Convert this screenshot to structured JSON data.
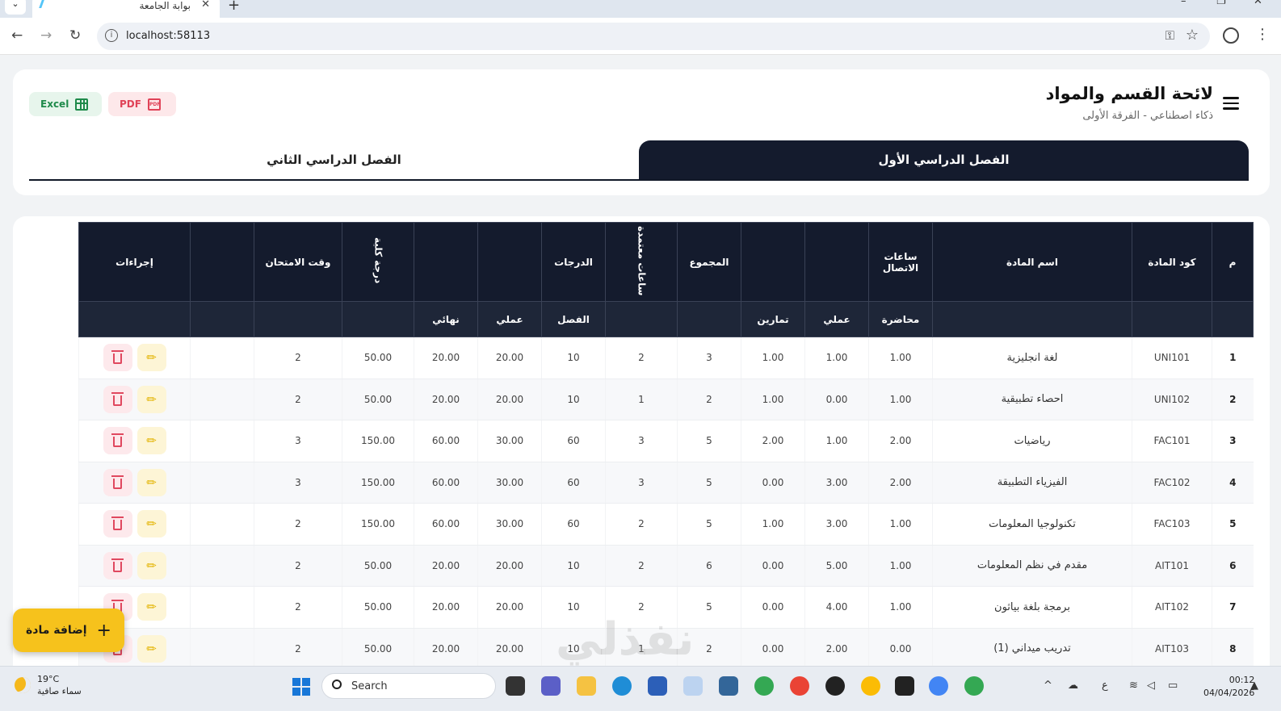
{
  "browser": {
    "tab_title": "بوابة الجامعة",
    "tab_close": "✕",
    "tab_menu": "⌄",
    "new_tab": "+",
    "back": "←",
    "forward": "→",
    "reload": "↻",
    "url": "localhost:58113",
    "win_min": "–",
    "win_max": "❐",
    "win_close": "✕"
  },
  "header": {
    "title": "لائحة القسم والمواد",
    "subtitle": "ذكاء اصطناعي - الفرقة الأولى",
    "excel_label": "Excel",
    "pdf_label": "PDF",
    "pdf_icon_text": "PDF"
  },
  "semester_tabs": {
    "first": "الفصل الدراسي الأول",
    "second": "الفصل الدراسي الثاني"
  },
  "table": {
    "headers": {
      "index": "م",
      "code": "كود المادة",
      "name": "اسم المادة",
      "contact_hours": "ساعات الاتصال",
      "total": "المجموع",
      "credit_hours": "ساعات معتمدة",
      "grades": "الدرجات",
      "total_grade": "درجة كلية",
      "exam_time": "وقت الامتحان",
      "actions": "إجراءات"
    },
    "subheaders": {
      "lecture": "محاضرة",
      "practical": "عملي",
      "exercises": "تمارين",
      "semester": "الفصل",
      "grade_practical": "عملي",
      "final": "نهائي"
    },
    "rows": [
      {
        "n": "1",
        "code": "UNI101",
        "name": "لغة انجليزية",
        "lec": "1.00",
        "prac": "1.00",
        "ex": "1.00",
        "total": "3",
        "credit": "2",
        "sem": "10",
        "gprac": "20.00",
        "final": "20.00",
        "grade": "50.00",
        "exam": "2"
      },
      {
        "n": "2",
        "code": "UNI102",
        "name": "احصاء تطبيقية",
        "lec": "1.00",
        "prac": "0.00",
        "ex": "1.00",
        "total": "2",
        "credit": "1",
        "sem": "10",
        "gprac": "20.00",
        "final": "20.00",
        "grade": "50.00",
        "exam": "2"
      },
      {
        "n": "3",
        "code": "FAC101",
        "name": "رياضيات",
        "lec": "2.00",
        "prac": "1.00",
        "ex": "2.00",
        "total": "5",
        "credit": "3",
        "sem": "60",
        "gprac": "30.00",
        "final": "60.00",
        "grade": "150.00",
        "exam": "3"
      },
      {
        "n": "4",
        "code": "FAC102",
        "name": "الفيزياء التطبيقة",
        "lec": "2.00",
        "prac": "3.00",
        "ex": "0.00",
        "total": "5",
        "credit": "3",
        "sem": "60",
        "gprac": "30.00",
        "final": "60.00",
        "grade": "150.00",
        "exam": "3"
      },
      {
        "n": "5",
        "code": "FAC103",
        "name": "تكنولوجيا المعلومات",
        "lec": "1.00",
        "prac": "3.00",
        "ex": "1.00",
        "total": "5",
        "credit": "2",
        "sem": "60",
        "gprac": "30.00",
        "final": "60.00",
        "grade": "150.00",
        "exam": "2"
      },
      {
        "n": "6",
        "code": "AIT101",
        "name": "مقدم في نظم المعلومات",
        "lec": "1.00",
        "prac": "5.00",
        "ex": "0.00",
        "total": "6",
        "credit": "2",
        "sem": "10",
        "gprac": "20.00",
        "final": "20.00",
        "grade": "50.00",
        "exam": "2"
      },
      {
        "n": "7",
        "code": "AIT102",
        "name": "برمجة بلغة بياثون",
        "lec": "1.00",
        "prac": "4.00",
        "ex": "0.00",
        "total": "5",
        "credit": "2",
        "sem": "10",
        "gprac": "20.00",
        "final": "20.00",
        "grade": "50.00",
        "exam": "2"
      },
      {
        "n": "8",
        "code": "AIT103",
        "name": "تدريب ميداني (1)",
        "lec": "0.00",
        "prac": "2.00",
        "ex": "0.00",
        "total": "2",
        "credit": "1",
        "sem": "10",
        "gprac": "20.00",
        "final": "20.00",
        "grade": "50.00",
        "exam": "2"
      }
    ]
  },
  "fab": {
    "label": "إضافة مادة",
    "plus": "+"
  },
  "watermark": "نفذلي",
  "taskbar": {
    "temp": "19°C",
    "weather": "سماء صافية",
    "search_placeholder": "Search",
    "lang": "ع",
    "time": "00:12",
    "date": "04/04/2026"
  },
  "colors": {
    "dark": "#141b2d",
    "accent": "#f6c21c",
    "danger": "#e0485f",
    "excel": "#1e8a4a"
  }
}
